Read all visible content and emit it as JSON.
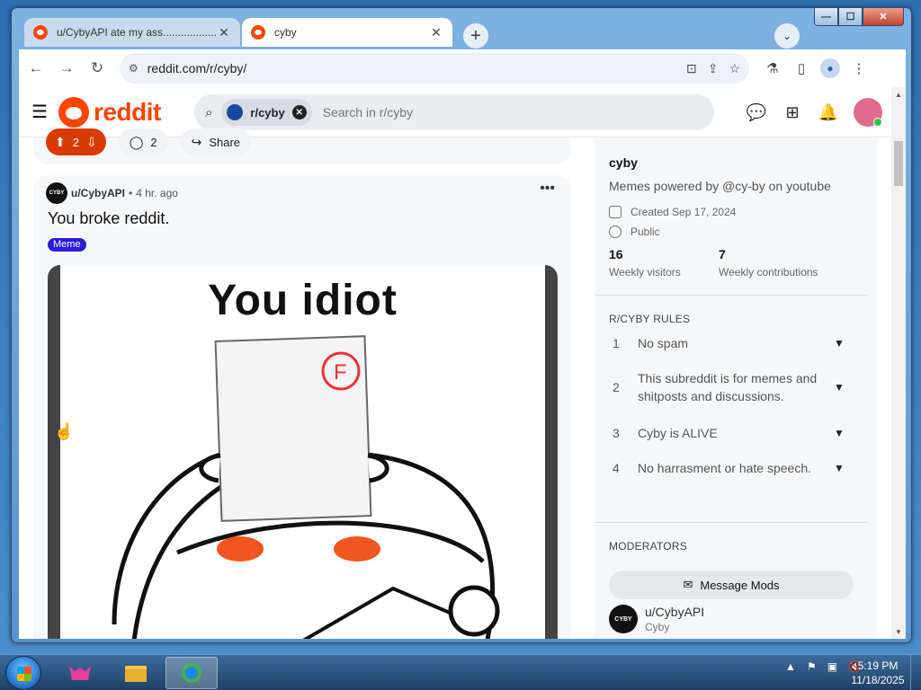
{
  "browser": {
    "tabs": [
      {
        "label": "u/CybyAPI ate my ass......................"
      },
      {
        "label": "cyby"
      }
    ],
    "new_tab_label": "+",
    "url": "reddit.com/r/cyby/",
    "window_controls": {
      "minimize": "—",
      "maximize": "☐",
      "close": "✕"
    }
  },
  "reddit": {
    "logo_text": "reddit",
    "search": {
      "chip_label": "r/cyby",
      "placeholder": "Search in r/cyby"
    },
    "prev_post": {
      "votes": "2",
      "comments": "2",
      "share_label": "Share"
    },
    "post": {
      "author": "u/CybyAPI",
      "avatar_text": "CYBY",
      "time": "4 hr. ago",
      "title": "You broke reddit.",
      "flair": "Meme",
      "image_caption": "You idiot"
    },
    "sidebar": {
      "name": "cyby",
      "description": "Memes powered by @cy-by on youtube",
      "created": "Created Sep 17, 2024",
      "visibility": "Public",
      "stats": [
        {
          "num": "16",
          "label": "Weekly visitors"
        },
        {
          "num": "7",
          "label": "Weekly contributions"
        }
      ],
      "rules_heading": "R/CYBY RULES",
      "rules": [
        {
          "n": "1",
          "text": "No spam"
        },
        {
          "n": "2",
          "text": "This subreddit is for memes and shitposts and discussions."
        },
        {
          "n": "3",
          "text": "Cyby is ALIVE"
        },
        {
          "n": "4",
          "text": "No harrasment or hate speech."
        }
      ],
      "moderators_heading": "MODERATORS",
      "message_mods_label": "Message Mods",
      "moderator": {
        "name": "u/CybyAPI",
        "flair": "Cyby"
      }
    }
  },
  "taskbar": {
    "clock_time": "5:19 PM",
    "clock_date": "11/18/2025"
  },
  "colors": {
    "reddit_orange": "#ff4500",
    "upvote_active": "#d93a00",
    "flair_bg": "#2b1bd8"
  }
}
